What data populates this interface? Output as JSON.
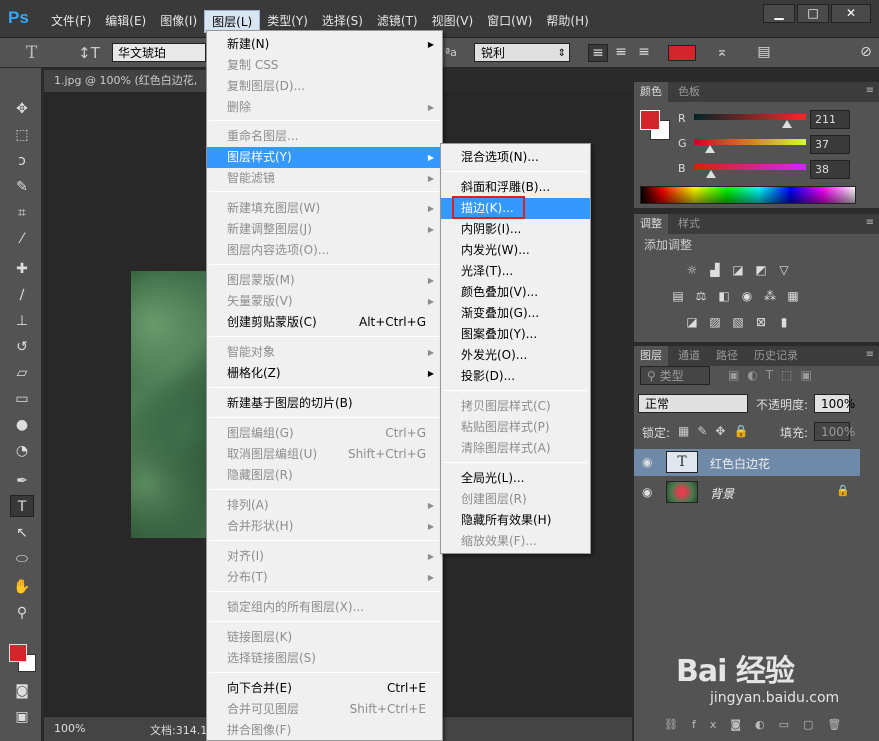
{
  "app": {
    "logo": "Ps"
  },
  "menubar": {
    "items": [
      "文件(F)",
      "编辑(E)",
      "图像(I)",
      "图层(L)",
      "类型(Y)",
      "选择(S)",
      "滤镜(T)",
      "视图(V)",
      "窗口(W)",
      "帮助(H)"
    ],
    "active_index": 3
  },
  "window_controls": [
    "▁",
    "□",
    "✕"
  ],
  "options": {
    "font_family": "华文琥珀",
    "aa_label": "ªa",
    "aa_mode": "锐利",
    "color": "#d3252a"
  },
  "document": {
    "tab_title": "1.jpg @ 100% (红色白边花,",
    "zoom": "100%",
    "doc_info": "文档:314.1"
  },
  "layer_menu": {
    "items": [
      {
        "label": "新建(N)",
        "shortcut": "",
        "arrow": true,
        "disabled": false
      },
      {
        "label": "复制 CSS",
        "shortcut": "",
        "arrow": false,
        "disabled": true
      },
      {
        "label": "复制图层(D)...",
        "shortcut": "",
        "arrow": false,
        "disabled": true
      },
      {
        "label": "删除",
        "shortcut": "",
        "arrow": true,
        "disabled": true
      },
      {
        "label": "重命名图层...",
        "shortcut": "",
        "arrow": false,
        "disabled": true
      },
      {
        "label": "图层样式(Y)",
        "shortcut": "",
        "arrow": true,
        "disabled": false,
        "highlight": true
      },
      {
        "label": "智能滤镜",
        "shortcut": "",
        "arrow": true,
        "disabled": true
      },
      {
        "label": "新建填充图层(W)",
        "shortcut": "",
        "arrow": true,
        "disabled": true
      },
      {
        "label": "新建调整图层(J)",
        "shortcut": "",
        "arrow": true,
        "disabled": true
      },
      {
        "label": "图层内容选项(O)...",
        "shortcut": "",
        "arrow": false,
        "disabled": true
      },
      {
        "label": "图层蒙版(M)",
        "shortcut": "",
        "arrow": true,
        "disabled": true
      },
      {
        "label": "矢量蒙版(V)",
        "shortcut": "",
        "arrow": true,
        "disabled": true
      },
      {
        "label": "创建剪贴蒙版(C)",
        "shortcut": "Alt+Ctrl+G",
        "arrow": false,
        "disabled": false
      },
      {
        "label": "智能对象",
        "shortcut": "",
        "arrow": true,
        "disabled": true
      },
      {
        "label": "栅格化(Z)",
        "shortcut": "",
        "arrow": true,
        "disabled": false
      },
      {
        "label": "新建基于图层的切片(B)",
        "shortcut": "",
        "arrow": false,
        "disabled": false
      },
      {
        "label": "图层编组(G)",
        "shortcut": "Ctrl+G",
        "arrow": false,
        "disabled": true
      },
      {
        "label": "取消图层编组(U)",
        "shortcut": "Shift+Ctrl+G",
        "arrow": false,
        "disabled": true
      },
      {
        "label": "隐藏图层(R)",
        "shortcut": "",
        "arrow": false,
        "disabled": true
      },
      {
        "label": "排列(A)",
        "shortcut": "",
        "arrow": true,
        "disabled": true
      },
      {
        "label": "合并形状(H)",
        "shortcut": "",
        "arrow": true,
        "disabled": true
      },
      {
        "label": "对齐(I)",
        "shortcut": "",
        "arrow": true,
        "disabled": true
      },
      {
        "label": "分布(T)",
        "shortcut": "",
        "arrow": true,
        "disabled": true
      },
      {
        "label": "锁定组内的所有图层(X)...",
        "shortcut": "",
        "arrow": false,
        "disabled": true
      },
      {
        "label": "链接图层(K)",
        "shortcut": "",
        "arrow": false,
        "disabled": true
      },
      {
        "label": "选择链接图层(S)",
        "shortcut": "",
        "arrow": false,
        "disabled": true
      },
      {
        "label": "向下合并(E)",
        "shortcut": "Ctrl+E",
        "arrow": false,
        "disabled": false
      },
      {
        "label": "合并可见图层",
        "shortcut": "Shift+Ctrl+E",
        "arrow": false,
        "disabled": true
      },
      {
        "label": "拼合图像(F)",
        "shortcut": "",
        "arrow": false,
        "disabled": true
      }
    ]
  },
  "style_submenu": {
    "items": [
      {
        "label": "混合选项(N)...",
        "disabled": false
      },
      {
        "label": "斜面和浮雕(B)...",
        "disabled": false
      },
      {
        "label": "描边(K)...",
        "disabled": false,
        "highlight": true
      },
      {
        "label": "内阴影(I)...",
        "disabled": false
      },
      {
        "label": "内发光(W)...",
        "disabled": false
      },
      {
        "label": "光泽(T)...",
        "disabled": false
      },
      {
        "label": "颜色叠加(V)...",
        "disabled": false
      },
      {
        "label": "渐变叠加(G)...",
        "disabled": false
      },
      {
        "label": "图案叠加(Y)...",
        "disabled": false
      },
      {
        "label": "外发光(O)...",
        "disabled": false
      },
      {
        "label": "投影(D)...",
        "disabled": false
      },
      {
        "label": "拷贝图层样式(C)",
        "disabled": true
      },
      {
        "label": "粘贴图层样式(P)",
        "disabled": true
      },
      {
        "label": "清除图层样式(A)",
        "disabled": true
      },
      {
        "label": "全局光(L)...",
        "disabled": false
      },
      {
        "label": "创建图层(R)",
        "disabled": true
      },
      {
        "label": "隐藏所有效果(H)",
        "disabled": false
      },
      {
        "label": "缩放效果(F)...",
        "disabled": true
      }
    ]
  },
  "color_panel": {
    "tabs": [
      "颜色",
      "色板"
    ],
    "r_label": "R",
    "g_label": "G",
    "b_label": "B",
    "r": "211",
    "g": "37",
    "b": "38",
    "r_level": 0.827,
    "g_level": 0.145,
    "b_level": 0.149,
    "fg": "#d3252a"
  },
  "adjust_panel": {
    "tabs": [
      "调整",
      "样式"
    ],
    "title": "添加调整"
  },
  "layers_panel": {
    "tabs": [
      "图层",
      "通道",
      "路径",
      "历史记录"
    ],
    "filter": "类型",
    "blend_mode": "正常",
    "opacity_label": "不透明度:",
    "opacity": "100%",
    "lock_label": "锁定:",
    "fill_label": "填充:",
    "fill": "100%",
    "layers": [
      {
        "name": "红色白边花",
        "type": "text",
        "selected": true
      },
      {
        "name": "背景",
        "type": "image",
        "selected": false,
        "locked": true
      }
    ]
  },
  "watermark": {
    "text": "Bai 经验",
    "url": "jingyan.baidu.com"
  }
}
